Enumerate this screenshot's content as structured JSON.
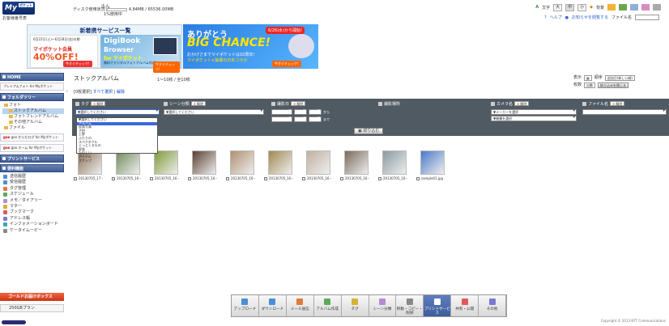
{
  "header": {
    "logo_text": "My",
    "logo_sub": "ポケット",
    "tagline": "お客様番号表",
    "user_suffix": "さん",
    "disk_label": "ディスク使用状況",
    "disk_usage": "4.84MB / 65536.00MB",
    "count_line": "1%使用中",
    "font_label": "文字",
    "font_sizes": [
      "大",
      "中",
      "小"
    ],
    "theme_label": "背景",
    "theme_colors": [
      "#f2b233",
      "#6aa84f",
      "#8fb0d9",
      "#d98cc0",
      "#a9a9a9"
    ],
    "help_link": "ヘルプ",
    "news_link": "お知らせを閲覧する",
    "file_search_label": "ファイル名"
  },
  "banners": {
    "new_services_title": "新着携サービス一覧",
    "promo_a": {
      "line1": "6月22日(土)〜6月28日(金)の期",
      "line2": "マイポケット会員",
      "line3": "40%OFF!",
      "button": "今すぐチェック!"
    },
    "promo_b": {
      "line1": "DigiBook",
      "line2": "Browser",
      "line3": "for マイポケット",
      "line4": "無料でデジタルフォトアルバム作成!",
      "button": "今すぐチェック!"
    },
    "big": {
      "line1": "ありがとう",
      "line2": "BIG CHANCE!",
      "line3": "おかげさまでマイポケットは10周年!",
      "line4": "マイポケット×抽選の日本コラボ",
      "date_badge": "6/26(水)から開始!",
      "button": "今すぐチェック!"
    }
  },
  "sidebar": {
    "home_label": "HOME",
    "partner_link": "プレミアムフォト for Myポケット",
    "folder_tree_label": "フォルダツリー",
    "folders": [
      {
        "label": "フォト",
        "level": 1,
        "selected": false
      },
      {
        "label": "ストックアルバム",
        "level": 2,
        "selected": true
      },
      {
        "label": "フォトフレンドアルバム",
        "level": 2,
        "selected": false
      },
      {
        "label": "その他アルバム",
        "level": 2,
        "selected": false
      },
      {
        "label": "ファイル",
        "level": 1,
        "selected": false
      }
    ],
    "goo_link_1": "goo からだログ for Myポケット",
    "goo_link_2": "goo ホーム for Myポケット",
    "print_service": "プリントサービス",
    "tools_label": "便利機能",
    "tools": [
      {
        "label": "送信履歴",
        "color": "#4a8fd6"
      },
      {
        "label": "受信履歴",
        "color": "#4a8fd6"
      },
      {
        "label": "タグ管理",
        "color": "#e07b3a"
      },
      {
        "label": "スケジュール",
        "color": "#5aaa5a"
      },
      {
        "label": "メモ／ダイアリー",
        "color": "#b58bd4"
      },
      {
        "label": "マネー",
        "color": "#d4b23a"
      },
      {
        "label": "ブックマーク",
        "color": "#e05a5a"
      },
      {
        "label": "アドレス帳",
        "color": "#7a7ad4"
      },
      {
        "label": "インフォメーションボード",
        "color": "#3aa8b8"
      },
      {
        "label": "ケータイムービー",
        "color": "#888888"
      }
    ],
    "gold_label": "ゴールドお届けボックス",
    "plan_label": "250GBプラン"
  },
  "main": {
    "title": "ストックアルバム",
    "count_text": "1〜10枚 / 全10枚",
    "display_label": "表示",
    "order_label": "順序",
    "order_value": "追加日(新しい順)",
    "per_page_label": "枚数",
    "per_page_value": "自動",
    "filter_reset_button": "絞り込みを閉じる",
    "selected_count": "[0枚選択]",
    "select_all": "すべて選択",
    "clear": "解除",
    "filters": {
      "tag_label": "タグ",
      "tag_clear": "解除",
      "tag_select": "▼選択してください",
      "scene_label": "シーン分類",
      "scene_clear": "解除",
      "scene_select": "▼選択してください",
      "date_label": "撮影日",
      "date_clear": "解除",
      "date_year": "----年",
      "date_month": "--月",
      "date_day": "--日",
      "date_from": "から",
      "date_to": "まで",
      "place_label": "撮影場所",
      "camera_label": "カメラ名",
      "camera_clear": "解除",
      "maker_select": "▼メーカーを選択",
      "model_select": "▼機種を選択",
      "filename_label": "ファイル名",
      "filename_clear": "解除"
    },
    "narrow_button": "絞り込む",
    "tag_options": [
      "▼選択してください",
      "アルバム",
      "家族写真",
      "子供",
      "上野",
      "ふたりの",
      "スペクタクル",
      "ぐっとくるもの",
      "家族",
      "たのしい",
      "アイドル",
      "スナップ"
    ],
    "photos": [
      {
        "caption": "20130705_17··",
        "color": "#8a7055"
      },
      {
        "caption": "20130705_16··",
        "color": "#6f8a5a"
      },
      {
        "caption": "20130705_16··",
        "color": "#7f9a3a"
      },
      {
        "caption": "20130705_16··",
        "color": "#5a4030"
      },
      {
        "caption": "20130705_16··",
        "color": "#b09070"
      },
      {
        "caption": "20130705_16··",
        "color": "#a08a50"
      },
      {
        "caption": "20130705_16··",
        "color": "#c0b0a0"
      },
      {
        "caption": "20130705_16··",
        "color": "#7a6a5a"
      },
      {
        "caption": "20130705_16··",
        "color": "#8a9aa0"
      },
      {
        "caption": "sample01.jpg",
        "color": "#4a78c8"
      }
    ]
  },
  "toolbar": {
    "buttons": [
      {
        "label": "アップロード",
        "color": "#4a8fd6",
        "active": false
      },
      {
        "label": "ダウンロード",
        "color": "#4a8fd6",
        "active": false
      },
      {
        "label": "メール送信",
        "color": "#e07b3a",
        "active": false
      },
      {
        "label": "アルバム作成",
        "color": "#5aaa5a",
        "active": false
      },
      {
        "label": "タグ",
        "color": "#d4b23a",
        "active": false
      },
      {
        "label": "シーン分類",
        "color": "#b58bd4",
        "active": false
      },
      {
        "label": "移動・コピー・削除",
        "color": "#888888",
        "active": false
      },
      {
        "label": "プリントサービス",
        "color": "#ffffff",
        "active": true
      },
      {
        "label": "共有・公開",
        "color": "#e05a5a",
        "active": false
      },
      {
        "label": "その他",
        "color": "#7a7ad4",
        "active": false
      }
    ]
  },
  "footer": {
    "copyright": "Copyright © 2013 NTT Communications"
  }
}
